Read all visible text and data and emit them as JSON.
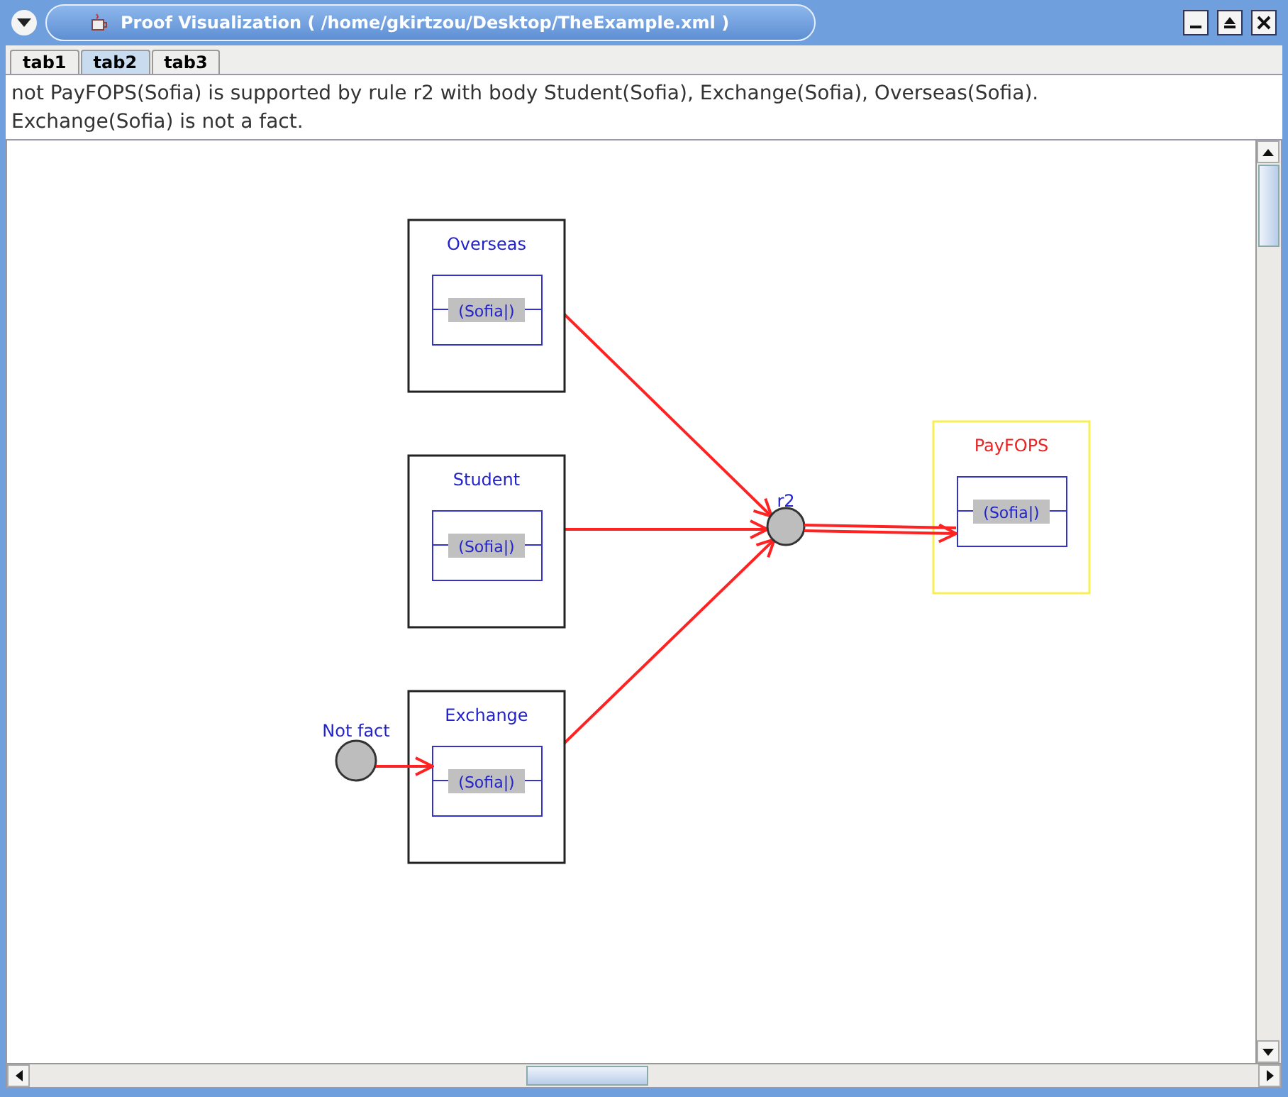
{
  "window": {
    "title": "Proof Visualization ( /home/gkirtzou/Desktop/TheExample.xml )"
  },
  "tabs": [
    {
      "label": "tab1",
      "selected": false
    },
    {
      "label": "tab2",
      "selected": true
    },
    {
      "label": "tab3",
      "selected": false
    }
  ],
  "message": [
    "not PayFOPS(Sofia) is supported by rule r2 with body Student(Sofia), Exchange(Sofia), Overseas(Sofia).",
    "Exchange(Sofia) is not a fact."
  ],
  "diagram": {
    "nodes": [
      {
        "kind": "predicate",
        "title": "Overseas",
        "argument": "(Sofia|)",
        "conclusion": false
      },
      {
        "kind": "predicate",
        "title": "Student",
        "argument": "(Sofia|)",
        "conclusion": false
      },
      {
        "kind": "predicate",
        "title": "Exchange",
        "argument": "(Sofia|)",
        "conclusion": false
      },
      {
        "kind": "predicate",
        "title": "PayFOPS",
        "argument": "(Sofia|)",
        "conclusion": true
      },
      {
        "kind": "rule",
        "label": "r2"
      },
      {
        "kind": "notfact",
        "label": "Not fact"
      }
    ]
  }
}
